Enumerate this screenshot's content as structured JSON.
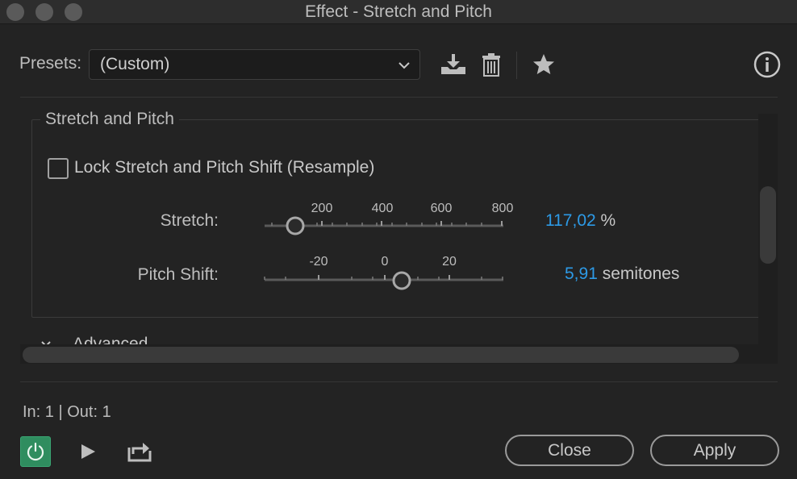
{
  "window": {
    "title": "Effect - Stretch and Pitch"
  },
  "presets": {
    "label": "Presets:",
    "value": "(Custom)"
  },
  "icons": [
    "save-preset-icon",
    "trash-icon",
    "star-icon",
    "info-icon"
  ],
  "group": {
    "title": "Stretch and Pitch",
    "lock_checkbox": {
      "label": "Lock Stretch and Pitch Shift (Resample)",
      "checked": false
    },
    "stretch": {
      "label": "Stretch:",
      "ticks": [
        "200",
        "400",
        "600",
        "800"
      ],
      "value": "117,02",
      "unit": "%"
    },
    "pitch": {
      "label": "Pitch Shift:",
      "ticks": [
        "-20",
        "0",
        "20"
      ],
      "value": "5,91",
      "unit": "semitones"
    }
  },
  "advanced": {
    "label": "Advanced"
  },
  "status": {
    "inout": "In: 1 | Out: 1"
  },
  "buttons": {
    "close": "Close",
    "apply": "Apply"
  },
  "colors": {
    "accent": "#2d9ae6",
    "power": "#2f8d5f"
  }
}
